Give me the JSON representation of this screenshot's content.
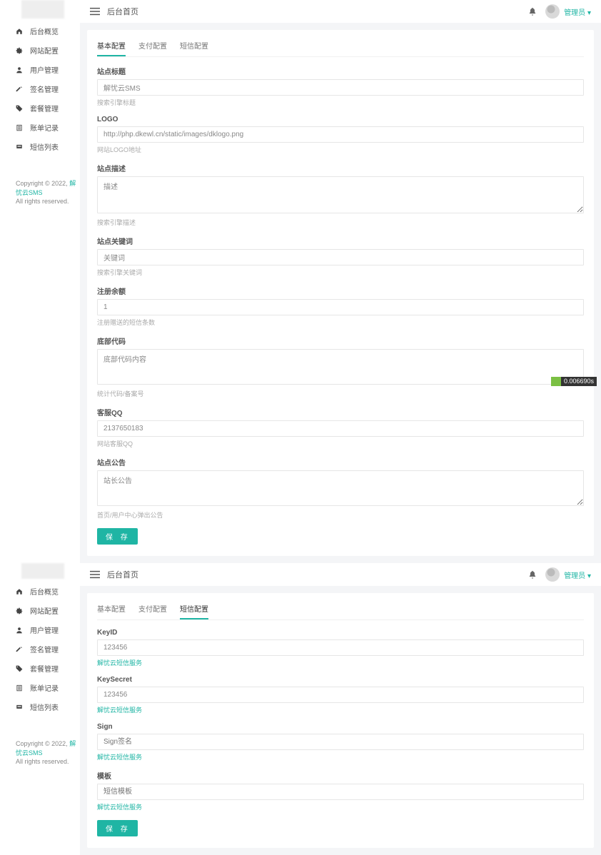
{
  "app": {
    "page_title": "后台首页",
    "user_role": "管理员",
    "copyright_prefix": "Copyright © 2022, ",
    "copyright_link": "解忧云SMS",
    "copyright_rights": "All rights reserved."
  },
  "sidebar": {
    "items": [
      {
        "icon": "home",
        "label": "后台概览"
      },
      {
        "icon": "gear",
        "label": "网站配置"
      },
      {
        "icon": "user",
        "label": "用户管理"
      },
      {
        "icon": "sign",
        "label": "签名管理"
      },
      {
        "icon": "tag",
        "label": "套餐管理"
      },
      {
        "icon": "list",
        "label": "账单记录"
      },
      {
        "icon": "msg",
        "label": "短信列表"
      }
    ]
  },
  "tabs": {
    "basic": "基本配置",
    "pay": "支付配置",
    "sms": "短信配置"
  },
  "panel1": {
    "fields": {
      "site_title": {
        "label": "站点标题",
        "value": "解忧云SMS",
        "hint": "搜索引擎标题"
      },
      "logo": {
        "label": "LOGO",
        "value": "http://php.dkewl.cn/static/images/dklogo.png",
        "hint": "网站LOGO地址"
      },
      "site_desc": {
        "label": "站点描述",
        "value": "描述",
        "hint": "搜索引擎描述"
      },
      "keywords": {
        "label": "站点关键词",
        "value": "关键词",
        "hint": "搜索引擎关键词"
      },
      "reg_balance": {
        "label": "注册余额",
        "value": "1",
        "hint": "注册赠送的短信条数"
      },
      "footer_code": {
        "label": "底部代码",
        "value": "底部代码内容",
        "hint": "统计代码/备案号"
      },
      "kefu_qq": {
        "label": "客服QQ",
        "value": "2137650183",
        "hint": "网站客服QQ"
      },
      "announce": {
        "label": "站点公告",
        "value": "站长公告",
        "hint": "首页/用户中心弹出公告"
      }
    },
    "save": "保 存"
  },
  "panel2": {
    "fields": {
      "keyid": {
        "label": "KeyID",
        "value": "123456",
        "link": "解忧云短信服务"
      },
      "keysecret": {
        "label": "KeySecret",
        "value": "123456",
        "link": "解忧云短信服务"
      },
      "sign": {
        "label": "Sign",
        "placeholder": "Sign签名",
        "link": "解忧云短信服务"
      },
      "tpl": {
        "label": "模板",
        "placeholder": "短信模板",
        "link": "解忧云短信服务"
      }
    },
    "save": "保 存"
  },
  "timer": "0.006690s",
  "icons": {
    "home": "⌂",
    "gear": "✿",
    "user": "",
    "sign": "",
    "tag": "",
    "list": "",
    "msg": "≣",
    "toggle": "≡",
    "bell": "⬤",
    "caret": "▾"
  }
}
